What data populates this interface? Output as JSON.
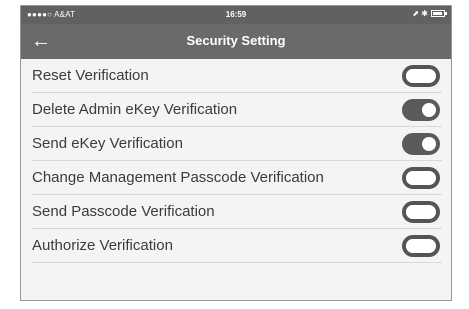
{
  "status_bar": {
    "carrier": "●●●●○ A&AT",
    "time": "16:59",
    "right_icons": "⬈ ✱"
  },
  "header": {
    "back_icon": "←",
    "title": "Security Setting"
  },
  "settings": [
    {
      "label": "Reset Verification",
      "enabled": false
    },
    {
      "label": "Delete Admin eKey Verification",
      "enabled": true
    },
    {
      "label": "Send eKey Verification",
      "enabled": true
    },
    {
      "label": "Change Management Passcode Verification",
      "enabled": false
    },
    {
      "label": "Send Passcode Verification",
      "enabled": false
    },
    {
      "label": "Authorize Verification",
      "enabled": false
    }
  ],
  "colors": {
    "nav_bg": "#6a6a6a",
    "status_bg": "#616161",
    "toggle_on": "#5a5a5a"
  }
}
